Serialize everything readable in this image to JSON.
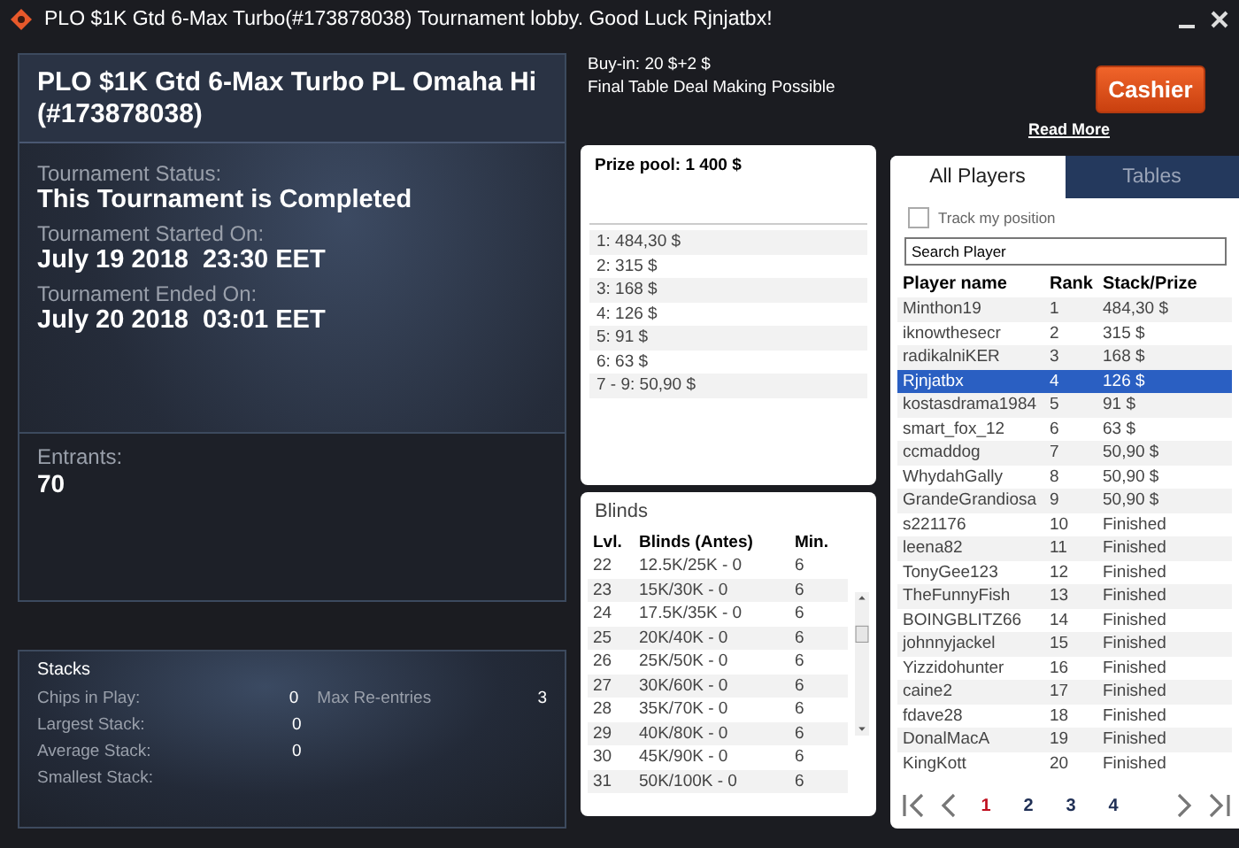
{
  "window": {
    "title": "PLO $1K Gtd 6-Max Turbo(#173878038) Tournament lobby. Good Luck Rjnjatbx!"
  },
  "info": {
    "title": "PLO $1K Gtd 6-Max Turbo PL Omaha Hi (#173878038)",
    "fields": [
      {
        "label": "Tournament Status:",
        "value": "This Tournament is Completed"
      },
      {
        "label": "Tournament Started On:",
        "value": "July 19 2018  23:30 EET"
      },
      {
        "label": "Tournament Ended On:",
        "value": "July 20 2018  03:01 EET"
      }
    ],
    "entrants": {
      "label": "Entrants:",
      "value": "70"
    }
  },
  "stacks": {
    "title": "Stacks",
    "rows": [
      {
        "label": "Chips in Play:",
        "value": "0",
        "extra_label": "Max Re-entries",
        "extra_value": "3"
      },
      {
        "label": "Largest Stack:",
        "value": "0"
      },
      {
        "label": "Average Stack:",
        "value": "0"
      },
      {
        "label": "Smallest Stack:"
      }
    ]
  },
  "buy_in": [
    "Buy-in: 20 $+2 $",
    "Final Table Deal Making Possible"
  ],
  "cashier_button": "Cashier",
  "read_more": "Read More",
  "prize_pool": {
    "title": "Prize pool: 1 400 $",
    "rows": [
      "1: 484,30 $",
      "2: 315 $",
      "3: 168 $",
      "4: 126 $",
      "5: 91 $",
      "6: 63 $",
      "7 - 9: 50,90 $"
    ]
  },
  "blinds": {
    "title": "Blinds",
    "columns": [
      "Lvl.",
      "Blinds (Antes)",
      "Min."
    ],
    "rows": [
      [
        "22",
        "12.5K/25K - 0",
        "6"
      ],
      [
        "23",
        "15K/30K - 0",
        "6"
      ],
      [
        "24",
        "17.5K/35K - 0",
        "6"
      ],
      [
        "25",
        "20K/40K - 0",
        "6"
      ],
      [
        "26",
        "25K/50K - 0",
        "6"
      ],
      [
        "27",
        "30K/60K - 0",
        "6"
      ],
      [
        "28",
        "35K/70K - 0",
        "6"
      ],
      [
        "29",
        "40K/80K - 0",
        "6"
      ],
      [
        "30",
        "45K/90K - 0",
        "6"
      ],
      [
        "31",
        "50K/100K - 0",
        "6"
      ]
    ]
  },
  "players": {
    "tabs": [
      {
        "label": "All Players",
        "selected": true
      },
      {
        "label": "Tables",
        "selected": false
      }
    ],
    "track_position": {
      "label": "Track my position",
      "checked": false
    },
    "search": {
      "value": "Search Player"
    },
    "columns": [
      "Player name",
      "Rank",
      "Stack/Prize"
    ],
    "rows": [
      {
        "cells": [
          "Minthon19",
          "1",
          "484,30 $"
        ],
        "selected": false
      },
      {
        "cells": [
          "iknowthesecr",
          "2",
          "315 $"
        ],
        "selected": false
      },
      {
        "cells": [
          "radikalniKER",
          "3",
          "168 $"
        ],
        "selected": false
      },
      {
        "cells": [
          "Rjnjatbx",
          "4",
          "126 $"
        ],
        "selected": true
      },
      {
        "cells": [
          "kostasdrama1984",
          "5",
          "91 $"
        ],
        "selected": false
      },
      {
        "cells": [
          "smart_fox_12",
          "6",
          "63 $"
        ],
        "selected": false
      },
      {
        "cells": [
          "ccmaddog",
          "7",
          "50,90 $"
        ],
        "selected": false
      },
      {
        "cells": [
          "WhydahGally",
          "8",
          "50,90 $"
        ],
        "selected": false
      },
      {
        "cells": [
          "GrandeGrandiosa",
          "9",
          "50,90 $"
        ],
        "selected": false
      },
      {
        "cells": [
          "s221176",
          "10",
          "Finished"
        ],
        "selected": false
      },
      {
        "cells": [
          "leena82",
          "11",
          "Finished"
        ],
        "selected": false
      },
      {
        "cells": [
          "TonyGee123",
          "12",
          "Finished"
        ],
        "selected": false
      },
      {
        "cells": [
          "TheFunnyFish",
          "13",
          "Finished"
        ],
        "selected": false
      },
      {
        "cells": [
          "BOINGBLITZ66",
          "14",
          "Finished"
        ],
        "selected": false
      },
      {
        "cells": [
          "johnnyjackel",
          "15",
          "Finished"
        ],
        "selected": false
      },
      {
        "cells": [
          "Yizzidohunter",
          "16",
          "Finished"
        ],
        "selected": false
      },
      {
        "cells": [
          "caine2",
          "17",
          "Finished"
        ],
        "selected": false
      },
      {
        "cells": [
          "fdave28",
          "18",
          "Finished"
        ],
        "selected": false
      },
      {
        "cells": [
          "DonalMacA",
          "19",
          "Finished"
        ],
        "selected": false
      },
      {
        "cells": [
          "KingKott",
          "20",
          "Finished"
        ],
        "selected": false
      }
    ],
    "pages": [
      {
        "label": "1",
        "selected": true
      },
      {
        "label": "2",
        "selected": false
      },
      {
        "label": "3",
        "selected": false
      },
      {
        "label": "4",
        "selected": false
      }
    ]
  }
}
